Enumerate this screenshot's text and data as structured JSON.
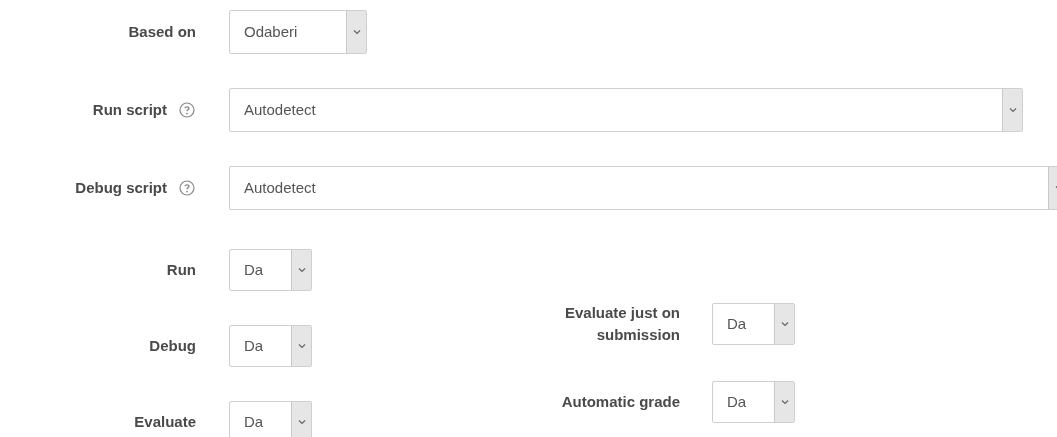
{
  "top_fields": [
    {
      "label": "Based on",
      "help": false,
      "kind": "compact",
      "value": "Odaberi"
    },
    {
      "label": "Run script",
      "help": true,
      "kind": "wide",
      "value": "Autodetect"
    },
    {
      "label": "Debug script",
      "help": true,
      "kind": "full",
      "value": "Autodetect"
    }
  ],
  "left_fields": [
    {
      "label": "Run",
      "value": "Da"
    },
    {
      "label": "Debug",
      "value": "Da"
    },
    {
      "label": "Evaluate",
      "value": "Da"
    }
  ],
  "right_fields": [
    {
      "label": "Evaluate just on submission",
      "value": "Da"
    },
    {
      "label": "Automatic grade",
      "value": "Da"
    }
  ]
}
